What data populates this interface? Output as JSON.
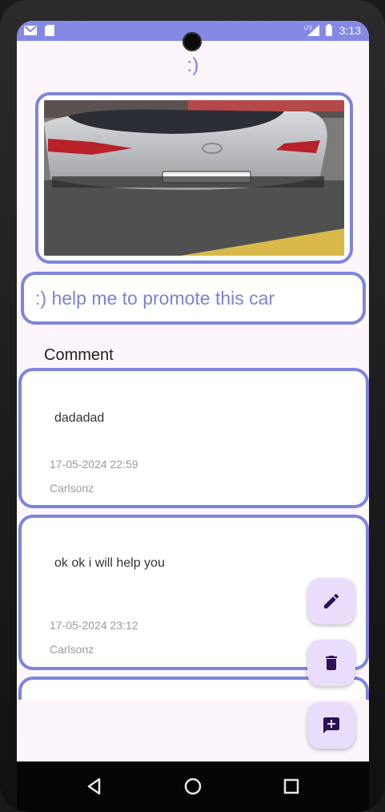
{
  "status_bar": {
    "time": "3:13",
    "icons": [
      "gmail-icon",
      "sd-card-icon",
      "lte-signal-icon",
      "battery-icon"
    ]
  },
  "post": {
    "title": ":)",
    "caption": ":) help me to promote this car",
    "image": "car-photo"
  },
  "comments_section": {
    "heading": "Comment",
    "items": [
      {
        "text": "dadadad",
        "date": "17-05-2024 22:59",
        "user": "Carlsonz"
      },
      {
        "text": "ok ok i will help you",
        "date": "17-05-2024 23:12",
        "user": "Carlsonz"
      }
    ]
  },
  "fabs": [
    {
      "name": "edit-button",
      "icon": "pencil-icon"
    },
    {
      "name": "delete-button",
      "icon": "trash-icon"
    },
    {
      "name": "add-comment-button",
      "icon": "add-comment-icon"
    }
  ],
  "nav": {
    "icons": [
      "back-icon",
      "home-icon",
      "recents-icon"
    ]
  },
  "colors": {
    "accent": "#7e84dd",
    "status_bar": "#8489e6",
    "fab": "#eadcfb",
    "fab_icon": "#2c1058",
    "background": "#fcf5fc"
  }
}
